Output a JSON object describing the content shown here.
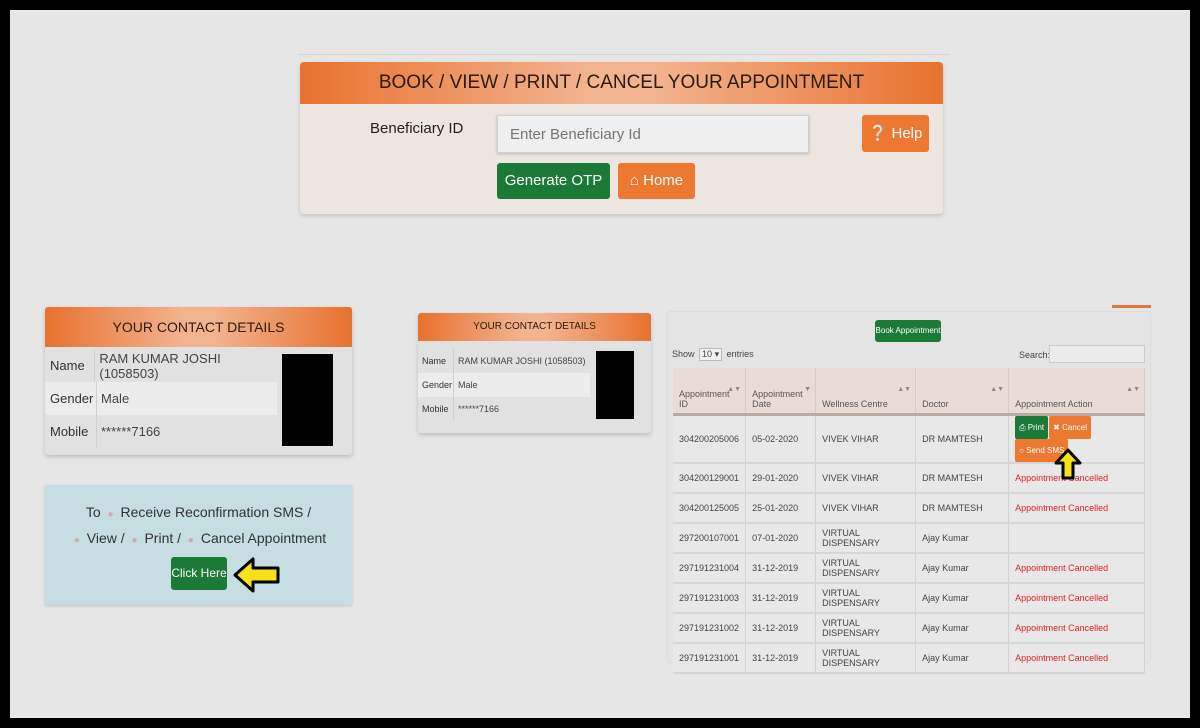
{
  "booking": {
    "title": "BOOK / VIEW / PRINT / CANCEL YOUR APPOINTMENT",
    "beneficiary_label": "Beneficiary ID",
    "beneficiary_placeholder": "Enter Beneficiary Id",
    "beneficiary_value": "",
    "help_label": "Help",
    "help_icon": "question-circle-icon",
    "generate_otp_label": "Generate OTP",
    "home_label": "Home",
    "home_icon": "home-icon"
  },
  "contact_large": {
    "title": "YOUR CONTACT DETAILS",
    "rows": [
      {
        "key": "Name",
        "value": "RAM KUMAR JOSHI (1058503)"
      },
      {
        "key": "Gender",
        "value": "Male"
      },
      {
        "key": "Mobile",
        "value": "******7166"
      }
    ]
  },
  "contact_small": {
    "title": "YOUR CONTACT DETAILS",
    "rows": [
      {
        "key": "Name",
        "value": "RAM KUMAR JOSHI (1058503)"
      },
      {
        "key": "Gender",
        "value": "Male"
      },
      {
        "key": "Mobile",
        "value": "******7166"
      }
    ]
  },
  "reconfirm": {
    "line1_prefix": "To",
    "line1_text": "Receive Reconfirmation SMS /",
    "line2_view": "View /",
    "line2_print": "Print /",
    "line2_cancel": "Cancel Appointment",
    "button_label": "Click Here"
  },
  "appointments": {
    "book_button": "Book Appointment",
    "show_label": "Show",
    "entries_value": "10",
    "entries_label": "entries",
    "search_label": "Search:",
    "search_value": "",
    "columns": [
      "Appointment ID",
      "Appointment Date",
      "Wellness Centre",
      "Doctor",
      "Appointment Action"
    ],
    "actions": {
      "print": "Print",
      "cancel": "Cancel",
      "send_sms": "Send SMS"
    },
    "rows": [
      {
        "id": "304200205006",
        "date": "05-02-2020",
        "centre": "VIVEK VIHAR",
        "doctor": "DR MAMTESH",
        "status": ""
      },
      {
        "id": "304200129001",
        "date": "29-01-2020",
        "centre": "VIVEK VIHAR",
        "doctor": "DR MAMTESH",
        "status": "Appointment Cancelled"
      },
      {
        "id": "304200125005",
        "date": "25-01-2020",
        "centre": "VIVEK VIHAR",
        "doctor": "DR MAMTESH",
        "status": "Appointment Cancelled"
      },
      {
        "id": "297200107001",
        "date": "07-01-2020",
        "centre": "VIRTUAL DISPENSARY",
        "doctor": "Ajay Kumar",
        "status": ""
      },
      {
        "id": "297191231004",
        "date": "31-12-2019",
        "centre": "VIRTUAL DISPENSARY",
        "doctor": "Ajay Kumar",
        "status": "Appointment Cancelled"
      },
      {
        "id": "297191231003",
        "date": "31-12-2019",
        "centre": "VIRTUAL DISPENSARY",
        "doctor": "Ajay Kumar",
        "status": "Appointment Cancelled"
      },
      {
        "id": "297191231002",
        "date": "31-12-2019",
        "centre": "VIRTUAL DISPENSARY",
        "doctor": "Ajay Kumar",
        "status": "Appointment Cancelled"
      },
      {
        "id": "297191231001",
        "date": "31-12-2019",
        "centre": "VIRTUAL DISPENSARY",
        "doctor": "Ajay Kumar",
        "status": "Appointment Cancelled"
      }
    ]
  },
  "colors": {
    "orange": "#ec7832",
    "green": "#1b7a35",
    "cancelled_red": "#e0202a",
    "highlight_arrow": "#f5e21a"
  }
}
